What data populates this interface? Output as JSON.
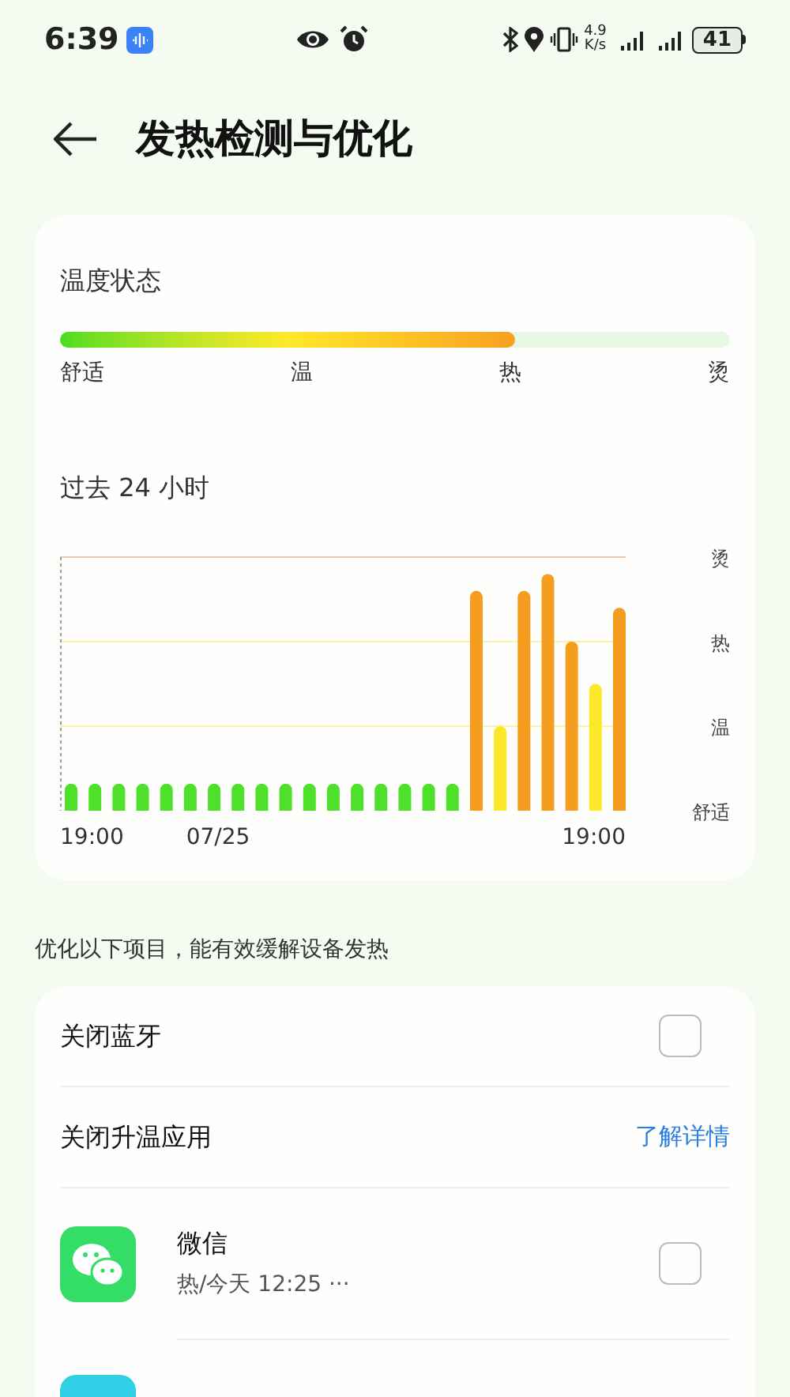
{
  "status_bar": {
    "time": "6:39",
    "speed_value": "4.9",
    "speed_unit": "K/s",
    "battery": "41"
  },
  "header": {
    "title": "发热检测与优化"
  },
  "temperature_state": {
    "title": "温度状态",
    "level": 0.68,
    "labels": [
      "舒适",
      "温",
      "热",
      "烫"
    ]
  },
  "history": {
    "title": "过去 24 小时",
    "x_axis_labels": [
      "19:00",
      "07/25",
      "19:00"
    ],
    "y_axis_labels": [
      "烫",
      "热",
      "温",
      "舒适"
    ]
  },
  "hint": "优化以下项目，能有效缓解设备发热",
  "options": [
    {
      "kind": "toggle",
      "label": "关闭蓝牙",
      "checked": false
    },
    {
      "kind": "section",
      "label": "关闭升温应用",
      "link": "了解详情"
    },
    {
      "kind": "app",
      "label": "微信",
      "detail": "热/今天 12:25 ···",
      "checked": false
    },
    {
      "kind": "app_cut"
    }
  ]
}
